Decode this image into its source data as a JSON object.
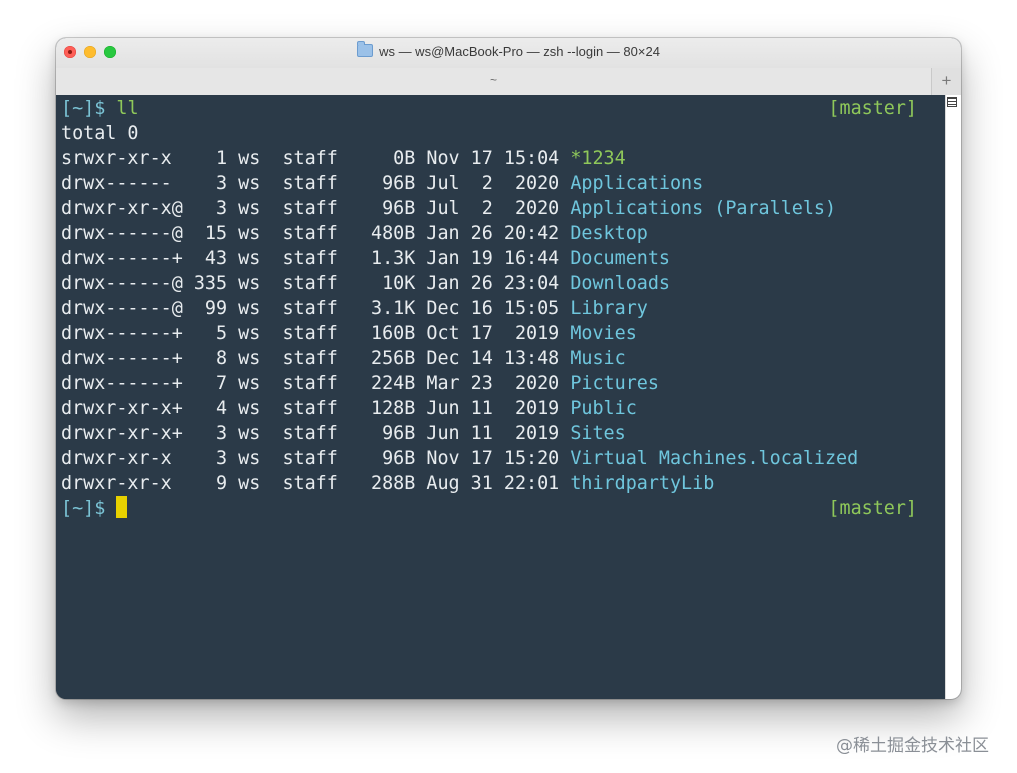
{
  "window": {
    "title": "ws — ws@MacBook-Pro — zsh --login — 80×24",
    "title_icon": "folder-icon",
    "tab_label": "~",
    "new_tab_label": "+"
  },
  "colors": {
    "terminal_bg": "#2b3a48",
    "text": "#e8ecef",
    "prompt": "#7bc4d6",
    "git_branch": "#8fc85a",
    "directory": "#6fc6dd",
    "socket": "#8fc85a",
    "cursor": "#e8d100"
  },
  "terminal": {
    "prompt_line": {
      "prompt": "[~]$",
      "command": " ll",
      "branch": "[master]"
    },
    "total": "total 0",
    "listing": [
      {
        "meta": "srwxr-xr-x    1 ws  staff     0B Nov 17 15:04 ",
        "name": "*1234",
        "kind": "socket"
      },
      {
        "meta": "drwx------    3 ws  staff    96B Jul  2  2020 ",
        "name": "Applications",
        "kind": "dir"
      },
      {
        "meta": "drwxr-xr-x@   3 ws  staff    96B Jul  2  2020 ",
        "name": "Applications (Parallels)",
        "kind": "dir"
      },
      {
        "meta": "drwx------@  15 ws  staff   480B Jan 26 20:42 ",
        "name": "Desktop",
        "kind": "dir"
      },
      {
        "meta": "drwx------+  43 ws  staff   1.3K Jan 19 16:44 ",
        "name": "Documents",
        "kind": "dir"
      },
      {
        "meta": "drwx------@ 335 ws  staff    10K Jan 26 23:04 ",
        "name": "Downloads",
        "kind": "dir"
      },
      {
        "meta": "drwx------@  99 ws  staff   3.1K Dec 16 15:05 ",
        "name": "Library",
        "kind": "dir"
      },
      {
        "meta": "drwx------+   5 ws  staff   160B Oct 17  2019 ",
        "name": "Movies",
        "kind": "dir"
      },
      {
        "meta": "drwx------+   8 ws  staff   256B Dec 14 13:48 ",
        "name": "Music",
        "kind": "dir"
      },
      {
        "meta": "drwx------+   7 ws  staff   224B Mar 23  2020 ",
        "name": "Pictures",
        "kind": "dir"
      },
      {
        "meta": "drwxr-xr-x+   4 ws  staff   128B Jun 11  2019 ",
        "name": "Public",
        "kind": "dir"
      },
      {
        "meta": "drwxr-xr-x+   3 ws  staff    96B Jun 11  2019 ",
        "name": "Sites",
        "kind": "dir"
      },
      {
        "meta": "drwxr-xr-x    3 ws  staff    96B Nov 17 15:20 ",
        "name": "Virtual Machines.localized",
        "kind": "dir"
      },
      {
        "meta": "drwxr-xr-x    9 ws  staff   288B Aug 31 22:01 ",
        "name": "thirdpartyLib",
        "kind": "dir"
      }
    ],
    "final_prompt": {
      "prompt": "[~]$",
      "branch": "[master]"
    }
  },
  "watermark": "@稀土掘金技术社区"
}
